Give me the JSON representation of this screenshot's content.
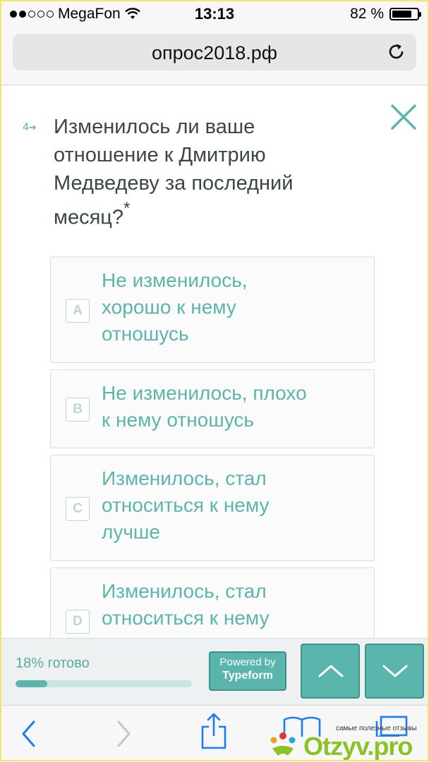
{
  "status_bar": {
    "carrier": "MegaFon",
    "time": "13:13",
    "battery": "82 %",
    "battery_level": 0.82,
    "signal_bars_filled": 2,
    "signal_bars_total": 5
  },
  "browser": {
    "url": "опрос2018.рф"
  },
  "question": {
    "number": "4",
    "text": "Изменилось ли ваше отношение к Дмитрию Медведеву за последний месяц?",
    "required_mark": "*"
  },
  "choices": [
    {
      "key": "A",
      "label": "Не изменилось, хорошо к нему отношусь"
    },
    {
      "key": "B",
      "label": "Не изменилось, плохо к нему отношусь"
    },
    {
      "key": "C",
      "label": "Изменилось, стал относиться к нему лучше"
    },
    {
      "key": "D",
      "label": "Изменилось, стал относиться к нему"
    }
  ],
  "progress": {
    "label": "18% готово",
    "fraction": 0.18
  },
  "powered_by": {
    "line1": "Powered by",
    "line2": "Typeform"
  },
  "watermark": {
    "tagline": "самые полезные отзывы",
    "brand": "Otzyv.pro"
  },
  "colors": {
    "accent": "#5ab5ad",
    "accent_dark": "#3f8f89",
    "text": "#3b4648",
    "ios_blue": "#1a7cf5"
  },
  "icons": {
    "close": "close-icon",
    "reload": "reload-icon",
    "prev": "chevron-up-icon",
    "next": "chevron-down-icon",
    "back": "back-icon",
    "forward": "forward-icon",
    "share": "share-icon",
    "bookmarks": "bookmarks-icon",
    "tabs": "tabs-icon"
  }
}
